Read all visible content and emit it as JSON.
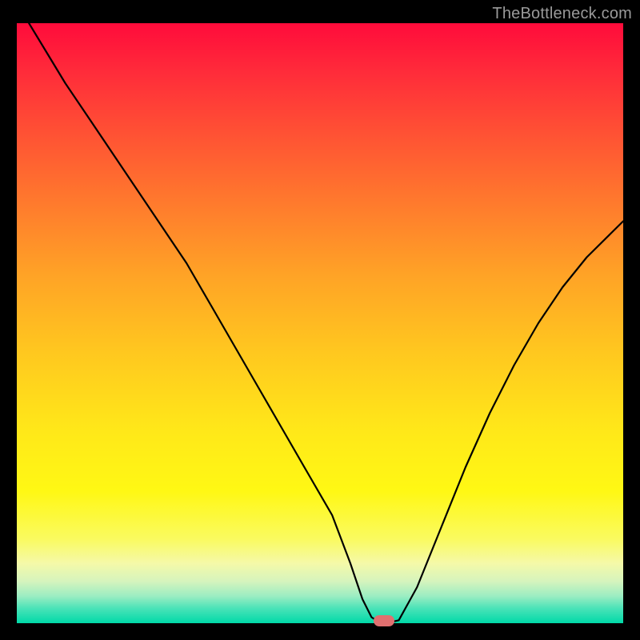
{
  "watermark": "TheBottleneck.com",
  "colors": {
    "page_bg": "#000000",
    "watermark_text": "#9a9a9a",
    "curve": "#000000",
    "marker": "#e07070",
    "gradient_top": "#ff0b3b",
    "gradient_bottom": "#00d9a8"
  },
  "chart_data": {
    "type": "line",
    "title": "",
    "xlabel": "",
    "ylabel": "",
    "xlim": [
      0,
      100
    ],
    "ylim": [
      0,
      100
    ],
    "grid": false,
    "series": [
      {
        "name": "bottleneck-curve",
        "x": [
          0,
          2,
          5,
          8,
          12,
          16,
          20,
          24,
          28,
          32,
          36,
          40,
          44,
          48,
          52,
          55,
          57,
          58.5,
          60,
          61,
          63,
          66,
          70,
          74,
          78,
          82,
          86,
          90,
          94,
          98,
          100
        ],
        "y": [
          104,
          100,
          95,
          90,
          84,
          78,
          72,
          66,
          60,
          53,
          46,
          39,
          32,
          25,
          18,
          10,
          4,
          1,
          0,
          0,
          0.5,
          6,
          16,
          26,
          35,
          43,
          50,
          56,
          61,
          65,
          67
        ]
      }
    ],
    "marker": {
      "x": 60.5,
      "y": 0
    }
  }
}
